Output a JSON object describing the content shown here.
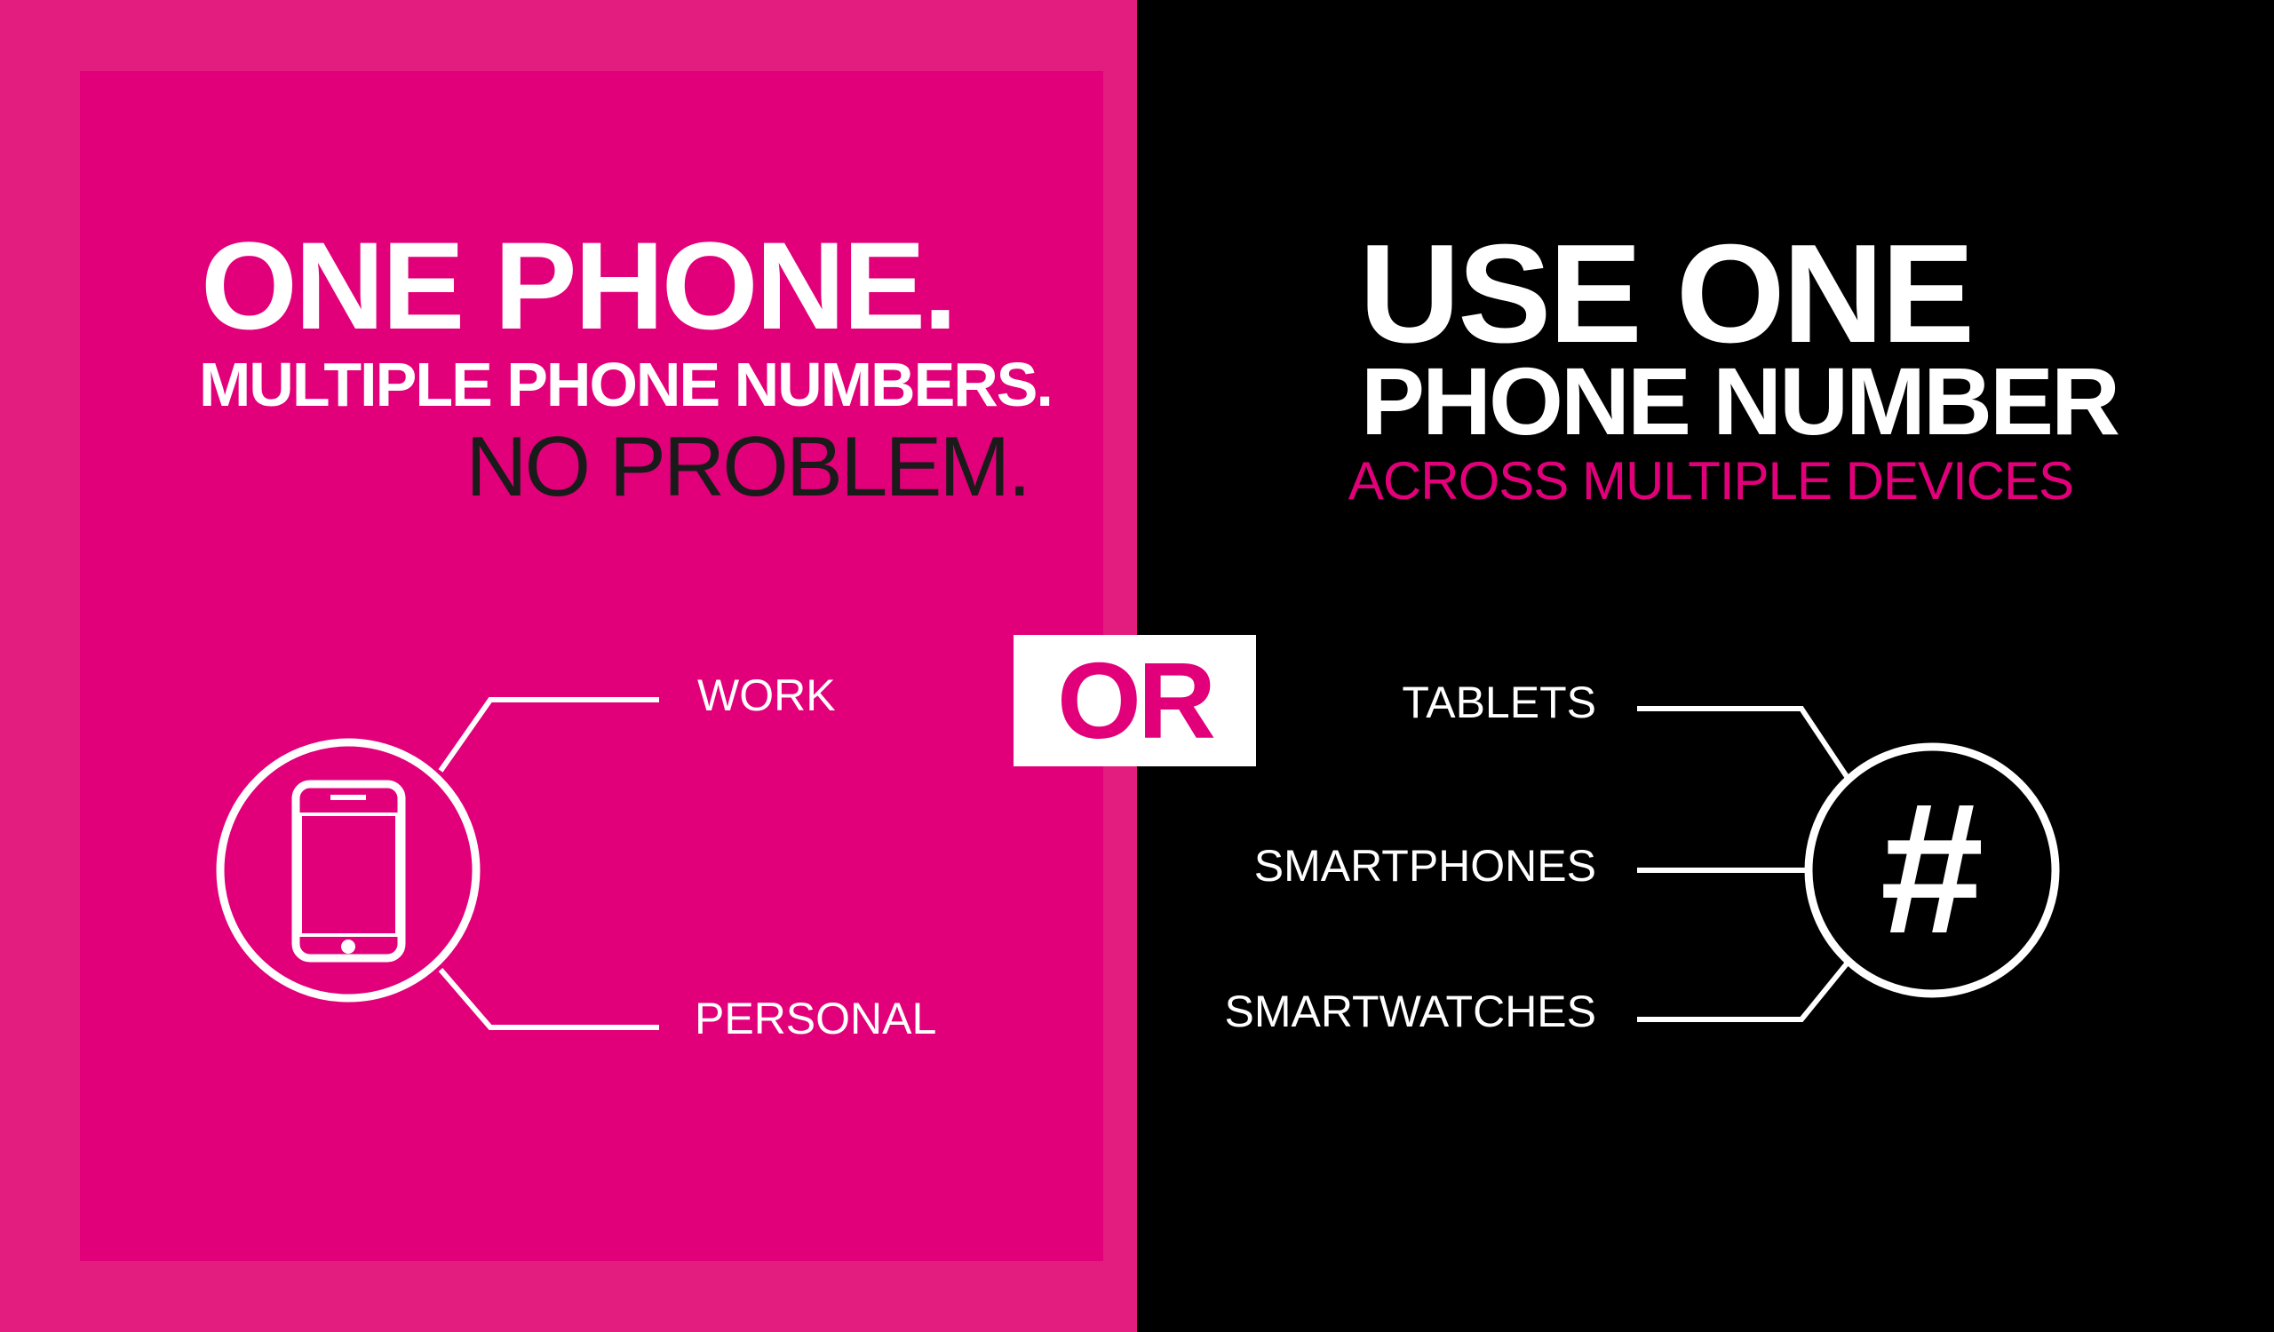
{
  "left": {
    "headline": "ONE PHONE.",
    "subheadline": "MULTIPLE PHONE NUMBERS.",
    "tagline": "NO PROBLEM.",
    "labels": [
      "WORK",
      "PERSONAL"
    ],
    "icon": "smartphone-icon"
  },
  "divider": {
    "text": "OR"
  },
  "right": {
    "headline": "USE ONE",
    "subheadline": "PHONE NUMBER",
    "tagline": "ACROSS MULTIPLE DEVICES",
    "labels": [
      "TABLETS",
      "SMARTPHONES",
      "SMARTWATCHES"
    ],
    "icon": "hashtag-icon",
    "hash_symbol": "#"
  },
  "colors": {
    "magenta": "#e2007a",
    "magenta_outer": "#e31c7f",
    "black": "#000000",
    "white": "#ffffff"
  }
}
